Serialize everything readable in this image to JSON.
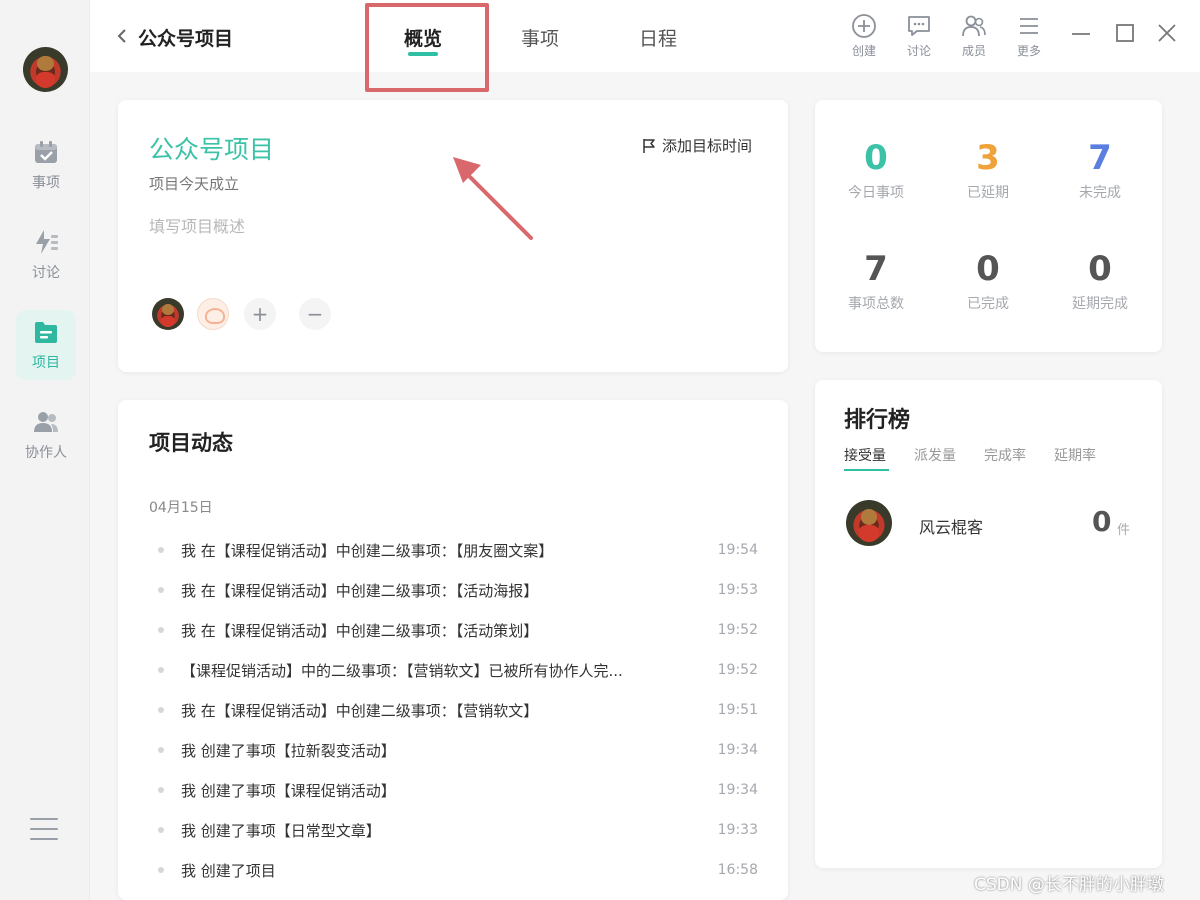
{
  "colors": {
    "accent": "#2fbfa3",
    "highlight_box": "#d9686c",
    "today": "#3cc2a7",
    "delayed": "#f0a23a",
    "incomplete": "#5b7fe0",
    "neutral_number": "#555555"
  },
  "sidebar": {
    "items": [
      {
        "label": "事项",
        "icon": "calendar-check-icon"
      },
      {
        "label": "讨论",
        "icon": "lightning-icon"
      },
      {
        "label": "项目",
        "icon": "folder-icon",
        "active": true
      },
      {
        "label": "协作人",
        "icon": "people-icon"
      }
    ],
    "menu_icon": "hamburger-icon"
  },
  "topbar": {
    "title": "公众号项目",
    "tabs": [
      {
        "label": "概览",
        "active": true
      },
      {
        "label": "事项"
      },
      {
        "label": "日程"
      }
    ],
    "tools": [
      {
        "label": "创建",
        "icon": "plus-circle-icon"
      },
      {
        "label": "讨论",
        "icon": "chat-icon"
      },
      {
        "label": "成员",
        "icon": "members-icon"
      },
      {
        "label": "更多",
        "icon": "menu-icon"
      }
    ]
  },
  "overview": {
    "name": "公众号项目",
    "created": "项目今天成立",
    "description_placeholder": "填写项目概述",
    "target_time": "添加目标时间",
    "add_member": "+",
    "remove_member": "−"
  },
  "stats": [
    {
      "value": "0",
      "label": "今日事项",
      "color": "#3cc2a7"
    },
    {
      "value": "3",
      "label": "已延期",
      "color": "#f0a23a"
    },
    {
      "value": "7",
      "label": "未完成",
      "color": "#5b7fe0"
    },
    {
      "value": "7",
      "label": "事项总数",
      "color": "#555555"
    },
    {
      "value": "0",
      "label": "已完成",
      "color": "#555555"
    },
    {
      "value": "0",
      "label": "延期完成",
      "color": "#555555"
    }
  ],
  "activity": {
    "title": "项目动态",
    "date": "04月15日",
    "items": [
      {
        "text": "我 在【课程促销活动】中创建二级事项：【朋友圈文案】",
        "time": "19:54"
      },
      {
        "text": "我 在【课程促销活动】中创建二级事项：【活动海报】",
        "time": "19:53"
      },
      {
        "text": "我 在【课程促销活动】中创建二级事项：【活动策划】",
        "time": "19:52"
      },
      {
        "text": "【课程促销活动】中的二级事项：【营销软文】已被所有协作人完...",
        "time": "19:52"
      },
      {
        "text": "我 在【课程促销活动】中创建二级事项：【营销软文】",
        "time": "19:51"
      },
      {
        "text": "我 创建了事项【拉新裂变活动】",
        "time": "19:34"
      },
      {
        "text": "我 创建了事项【课程促销活动】",
        "time": "19:34"
      },
      {
        "text": "我 创建了事项【日常型文章】",
        "time": "19:33"
      },
      {
        "text": "我 创建了项目",
        "time": "16:58"
      }
    ]
  },
  "ranking": {
    "title": "排行榜",
    "tabs": [
      "接受量",
      "派发量",
      "完成率",
      "延期率"
    ],
    "entries": [
      {
        "name": "风云棍客",
        "value": "0",
        "unit": "件"
      }
    ]
  },
  "watermark": "CSDN @长不胖的小胖墩"
}
